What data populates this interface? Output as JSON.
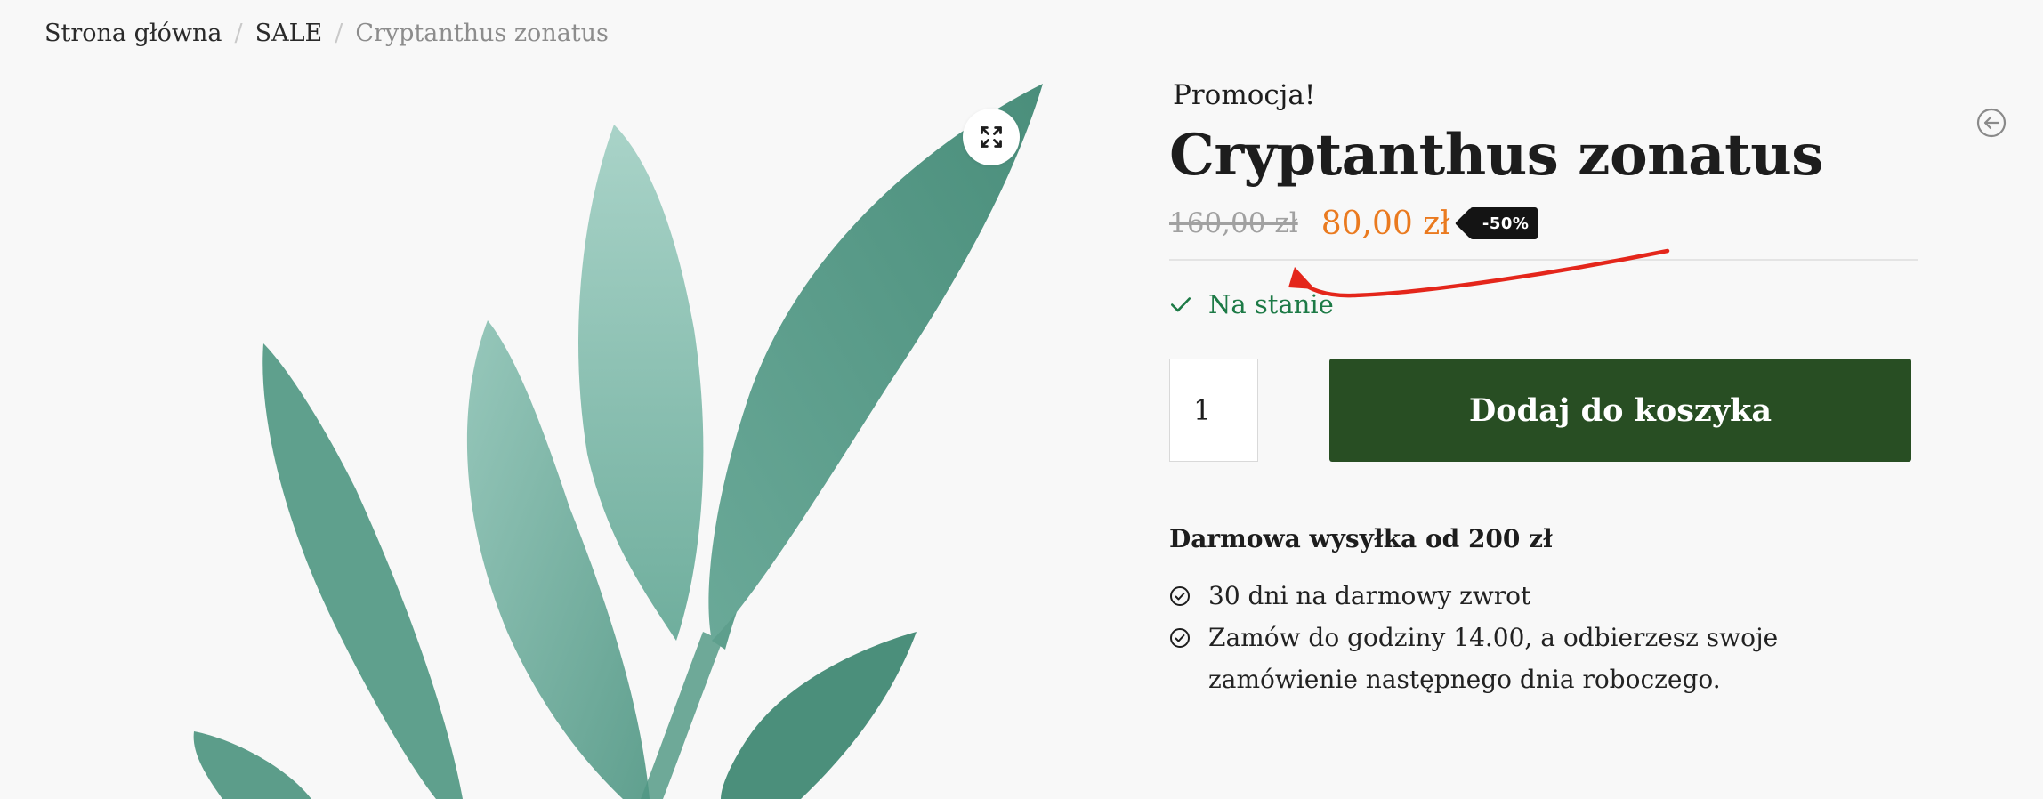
{
  "breadcrumb": {
    "home": "Strona główna",
    "category": "SALE",
    "current": "Cryptanthus zonatus",
    "separator": "/"
  },
  "gallery": {
    "zoom_icon": "expand-icon"
  },
  "product": {
    "sale_flash": "Promocja!",
    "title": "Cryptanthus zonatus",
    "old_price": "160,00 zł",
    "new_price": "80,00 zł",
    "discount": "-50%",
    "stock": "Na stanie",
    "quantity": "1",
    "add_to_cart": "Dodaj do koszyka"
  },
  "shipping": {
    "title": "Darmowa wysyłka od 200 zł",
    "perks": [
      "30 dni na darmowy zwrot",
      "Zamów do godziny 14.00, a odbierzesz swoje zamówienie następnego dnia roboczego."
    ]
  },
  "colors": {
    "accent_green": "#284e23",
    "stock_green": "#1d7a46",
    "price_orange": "#ea7a1f",
    "annotation_red": "#e4261b",
    "leaf": "#5a9e8c"
  }
}
